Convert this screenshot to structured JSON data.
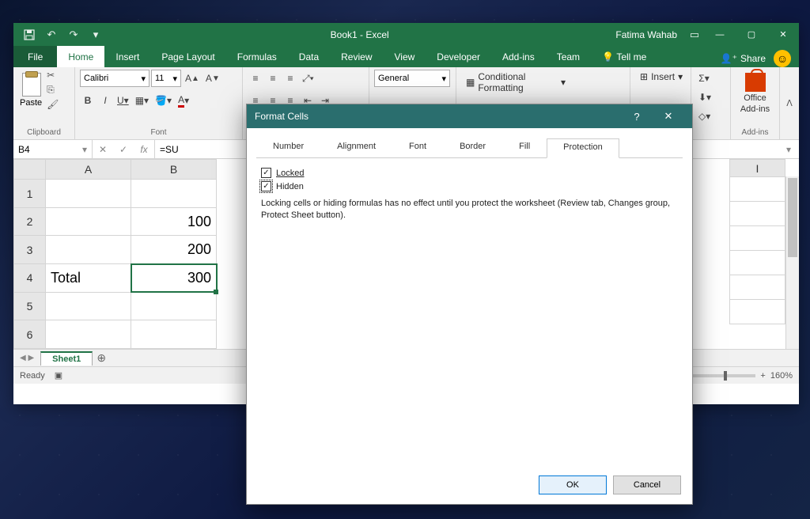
{
  "titlebar": {
    "title": "Book1 - Excel",
    "user": "Fatima Wahab"
  },
  "qat": {
    "save": "💾",
    "undo": "↶",
    "redo": "↷",
    "custom": "▾"
  },
  "winControls": {
    "min": "—",
    "max": "▢",
    "close": "✕"
  },
  "tabs": {
    "file": "File",
    "home": "Home",
    "insert": "Insert",
    "pageLayout": "Page Layout",
    "formulas": "Formulas",
    "data": "Data",
    "review": "Review",
    "view": "View",
    "developer": "Developer",
    "addins": "Add-ins",
    "team": "Team",
    "tellme": "Tell me"
  },
  "share": "Share",
  "ribbon": {
    "clipboard": {
      "label": "Clipboard",
      "paste": "Paste"
    },
    "font": {
      "label": "Font",
      "name": "Calibri",
      "size": "11",
      "bold": "B",
      "italic": "I",
      "underline": "U"
    },
    "number": {
      "format": "General"
    },
    "styles": {
      "cond": "Conditional Formatting"
    },
    "cells": {
      "insert": "Insert"
    },
    "editing": {
      "sum": "Σ"
    },
    "addins": {
      "label": "Add-ins",
      "office": "Office",
      "office2": "Add-ins"
    }
  },
  "formulaBar": {
    "nameBox": "B4",
    "formula": "=SU"
  },
  "grid": {
    "cols": [
      "A",
      "B",
      "I"
    ],
    "rows": [
      "1",
      "2",
      "3",
      "4",
      "5",
      "6"
    ],
    "cells": {
      "A4": "Total",
      "B2": "100",
      "B3": "200",
      "B4": "300"
    },
    "colWidths": {
      "A": 108,
      "B": 108,
      "I": 70
    }
  },
  "sheetTabs": {
    "active": "Sheet1",
    "add": "⊕"
  },
  "statusbar": {
    "ready": "Ready",
    "zoom": "160%",
    "minus": "−",
    "plus": "+"
  },
  "dialog": {
    "title": "Format Cells",
    "tabs": {
      "number": "Number",
      "alignment": "Alignment",
      "font": "Font",
      "border": "Border",
      "fill": "Fill",
      "protection": "Protection"
    },
    "locked": "Locked",
    "hidden": "Hidden",
    "info": "Locking cells or hiding formulas has no effect until you protect the worksheet (Review tab, Changes group, Protect Sheet button).",
    "ok": "OK",
    "cancel": "Cancel",
    "help": "?",
    "close": "✕"
  }
}
